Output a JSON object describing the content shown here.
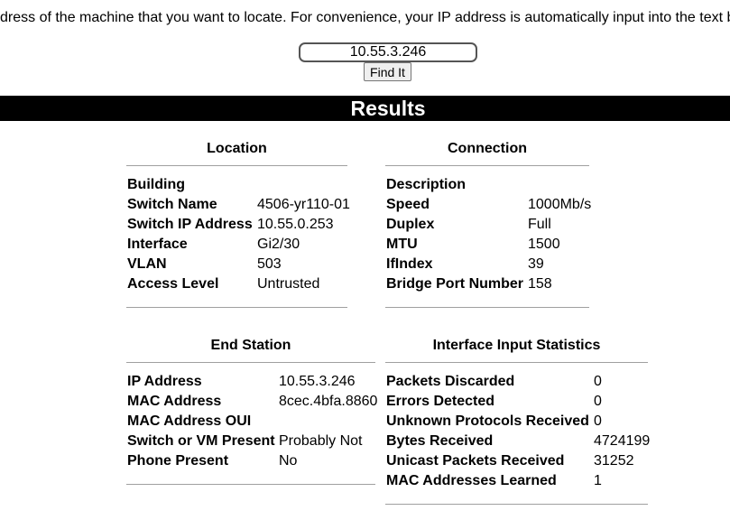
{
  "intro_text": "dress of the machine that you want to locate. For convenience, your IP address is automatically input into the text b",
  "search": {
    "value": "10.55.3.246",
    "button_label": "Find It"
  },
  "results_title": "Results",
  "panels": {
    "location": {
      "title": "Location",
      "rows": [
        {
          "label": "Building",
          "value": ""
        },
        {
          "label": "Switch Name",
          "value": "4506-yr110-01"
        },
        {
          "label": "Switch IP Address",
          "value": "10.55.0.253"
        },
        {
          "label": "Interface",
          "value": "Gi2/30"
        },
        {
          "label": "VLAN",
          "value": "503"
        },
        {
          "label": "Access Level",
          "value": "Untrusted"
        }
      ]
    },
    "connection": {
      "title": "Connection",
      "rows": [
        {
          "label": "Description",
          "value": ""
        },
        {
          "label": "Speed",
          "value": "1000Mb/s"
        },
        {
          "label": "Duplex",
          "value": "Full"
        },
        {
          "label": "MTU",
          "value": "1500"
        },
        {
          "label": "IfIndex",
          "value": "39"
        },
        {
          "label": "Bridge Port Number",
          "value": "158"
        }
      ]
    },
    "end_station": {
      "title": "End Station",
      "rows": [
        {
          "label": "IP Address",
          "value": "10.55.3.246"
        },
        {
          "label": "MAC Address",
          "value": "8cec.4bfa.8860"
        },
        {
          "label": "MAC Address OUI",
          "value": ""
        },
        {
          "label": "Switch or VM Present",
          "value": "Probably Not"
        },
        {
          "label": "Phone Present",
          "value": "No"
        }
      ]
    },
    "interface_stats": {
      "title": "Interface Input Statistics",
      "rows": [
        {
          "label": "Packets Discarded",
          "value": "0"
        },
        {
          "label": "Errors Detected",
          "value": "0"
        },
        {
          "label": "Unknown Protocols Received",
          "value": "0"
        },
        {
          "label": "Bytes Received",
          "value": "4724199"
        },
        {
          "label": "Unicast Packets Received",
          "value": "31252"
        },
        {
          "label": "MAC Addresses Learned",
          "value": "1"
        }
      ]
    }
  }
}
